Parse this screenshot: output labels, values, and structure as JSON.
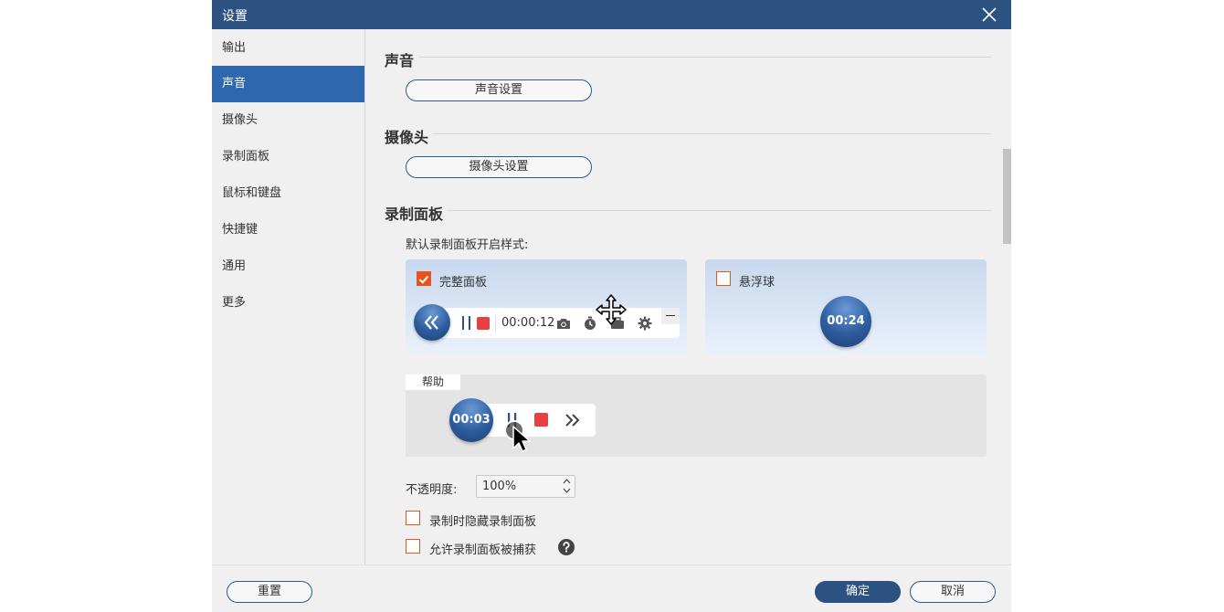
{
  "window": {
    "title": "设置"
  },
  "sidebar": {
    "items": [
      {
        "label": "输出"
      },
      {
        "label": "声音"
      },
      {
        "label": "摄像头"
      },
      {
        "label": "录制面板"
      },
      {
        "label": "鼠标和键盘"
      },
      {
        "label": "快捷键"
      },
      {
        "label": "通用"
      },
      {
        "label": "更多"
      }
    ],
    "active_index": 1
  },
  "sections": {
    "sound": {
      "title": "声音",
      "button": "声音设置"
    },
    "camera": {
      "title": "摄像头",
      "button": "摄像头设置"
    },
    "panel": {
      "title": "录制面板",
      "default_style_label": "默认录制面板开启样式:",
      "full_panel": {
        "label": "完整面板",
        "checked": true,
        "time": "00:00:12"
      },
      "float_ball": {
        "label": "悬浮球",
        "checked": false,
        "time": "00:24"
      },
      "help": {
        "tab": "帮助",
        "time": "00:03"
      },
      "opacity": {
        "label": "不透明度:",
        "value": "100%"
      },
      "hide_panel": {
        "label": "录制时隐藏录制面板",
        "checked": false
      },
      "allow_capture": {
        "label": "允许录制面板被捕获",
        "checked": false
      }
    }
  },
  "footer": {
    "reset": "重置",
    "ok": "确定",
    "cancel": "取消"
  },
  "colors": {
    "titlebar": "#2c5282",
    "accent": "#e8531c",
    "active_nav": "#2e67ad",
    "record_red": "#e84040"
  }
}
